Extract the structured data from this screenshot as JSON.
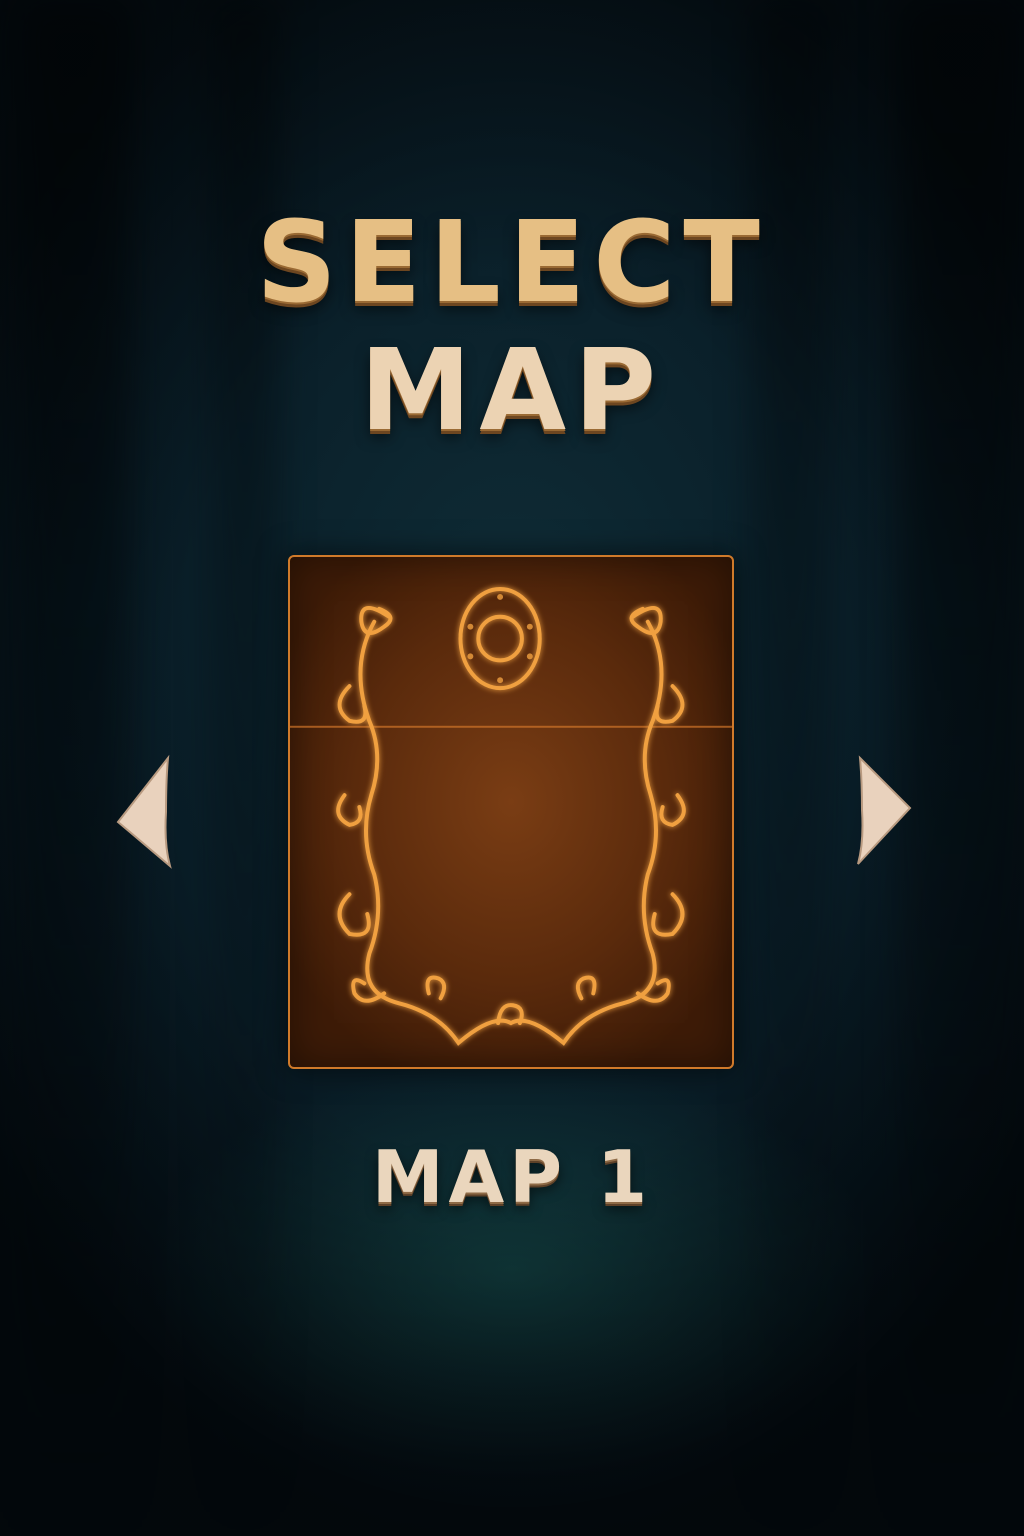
{
  "title": {
    "line1": "SELECT",
    "line2": "MAP"
  },
  "carousel": {
    "current_map_name": "MAP 1",
    "prev_icon": "triangle-left-icon",
    "next_icon": "triangle-right-icon",
    "preview_icon": "ornate-frame-icon"
  },
  "colors": {
    "title_gold": "#e6bf84",
    "title_cream": "#ecd3b3",
    "card_border": "#d07a2a",
    "card_bg": "#5a2a0c",
    "ornament": "#f0a040",
    "arrow_fill": "#e9d2bd",
    "background": "#0a1f29"
  }
}
